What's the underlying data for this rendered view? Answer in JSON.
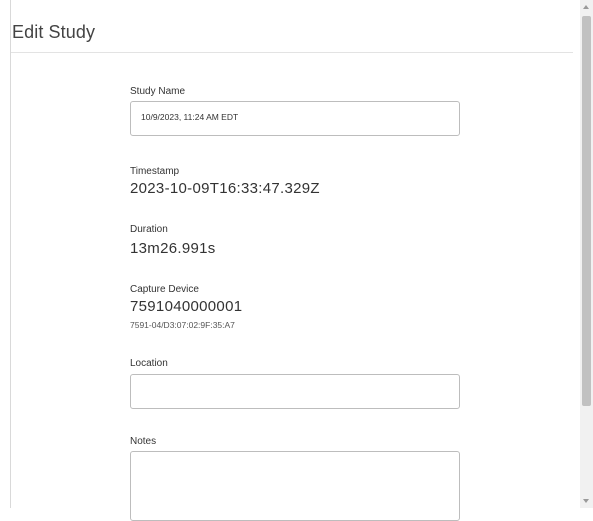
{
  "dialog": {
    "title": "Edit Study"
  },
  "form": {
    "study_name": {
      "label": "Study Name",
      "value": "10/9/2023, 11:24 AM EDT"
    },
    "timestamp": {
      "label": "Timestamp",
      "value": "2023-10-09T16:33:47.329Z"
    },
    "duration": {
      "label": "Duration",
      "value": "13m26.991s"
    },
    "capture_device": {
      "label": "Capture Device",
      "value": "7591040000001",
      "detail": "7591-04/D3:07:02:9F:35:A7"
    },
    "location": {
      "label": "Location",
      "value": ""
    },
    "notes": {
      "label": "Notes",
      "value": ""
    }
  },
  "colors": {
    "border": "#bdbdbd",
    "text": "#333333",
    "title": "#444444",
    "scroll_thumb": "#c1c1c1"
  }
}
